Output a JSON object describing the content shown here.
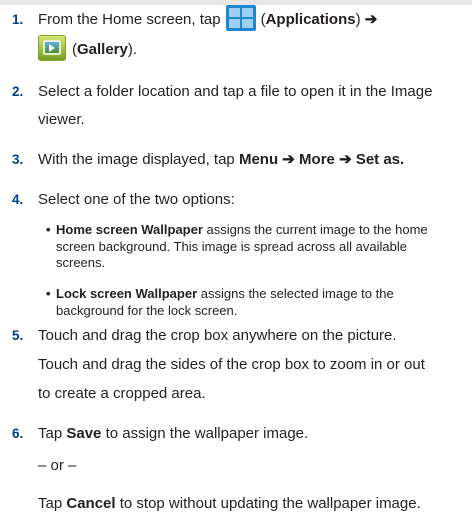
{
  "steps": [
    {
      "number": "1.",
      "line1_text": "From the Home screen, tap",
      "line1_open": "(",
      "line1_bold": "Applications",
      "line1_close": ")",
      "arrow": "➔",
      "line2_open": "(",
      "line2_bold": "Gallery",
      "line2_close": ").",
      "icons": [
        "applications-icon",
        "gallery-icon"
      ]
    },
    {
      "number": "2.",
      "line1": "Select a folder location and tap a file to open it in the Image",
      "line2": "viewer."
    },
    {
      "number": "3.",
      "text": "With the image displayed, tap",
      "menu": "Menu",
      "arrow1": "➔",
      "more": "More",
      "arrow2": "➔",
      "set_as": "Set as."
    },
    {
      "number": "4.",
      "text": "Select one of the two options:",
      "options": [
        {
          "bullet": "•",
          "bold": "Home screen Wallpaper",
          "line1_rest": " assigns the current image to the home",
          "line2": "screen background. This image is spread across all available",
          "line3": "screens."
        },
        {
          "bullet": "•",
          "bold": "Lock screen Wallpaper",
          "line1_rest": " assigns the selected image to the",
          "line2": "background for the lock screen."
        }
      ]
    },
    {
      "number": "5.",
      "line1": "Touch and drag the crop box anywhere on the picture.",
      "line2": "Touch and drag the sides of the crop box to zoom in or out",
      "line3": "to create a cropped area."
    },
    {
      "number": "6.",
      "tap": "Tap",
      "save": "Save",
      "save_rest": " to assign the wallpaper image.",
      "or": "– or –",
      "cancel": "Cancel",
      "cancel_rest": " to stop without updating the wallpaper image."
    }
  ],
  "colors": {
    "step_number": "#003f87",
    "body_text": "#231f20",
    "applications_icon": "#1d87d1",
    "gallery_icon": "#9ec13e"
  }
}
